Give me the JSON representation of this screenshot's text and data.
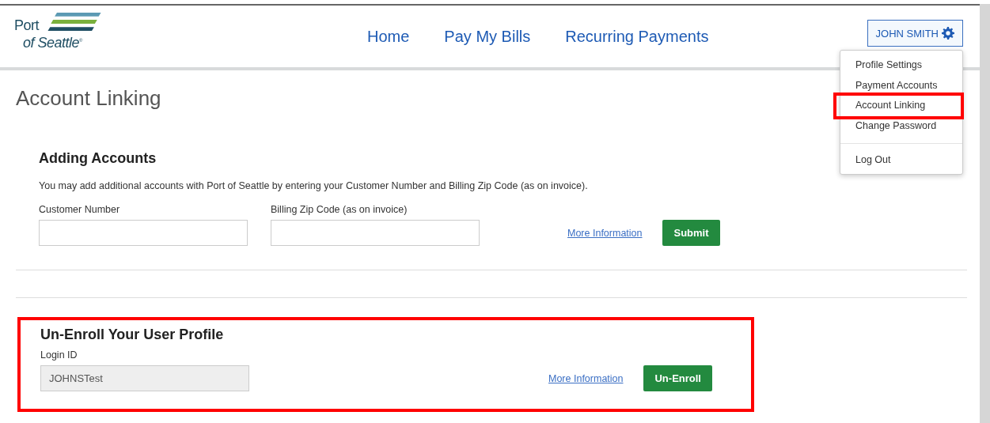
{
  "logo": {
    "line_1": "Port",
    "line_2": "of Seattle",
    "mark": "®"
  },
  "nav": [
    {
      "label": "Home"
    },
    {
      "label": "Pay My Bills"
    },
    {
      "label": "Recurring Payments"
    }
  ],
  "user_menu": {
    "label": "JOHN SMITH",
    "groups": [
      [
        {
          "label": "Profile Settings",
          "annotated": false
        },
        {
          "label": "Payment Accounts",
          "annotated": false
        },
        {
          "label": "Account Linking",
          "annotated": true
        },
        {
          "label": "Change Password",
          "annotated": false
        }
      ],
      [
        {
          "label": "Log Out",
          "annotated": false
        }
      ]
    ]
  },
  "page_title": "Account Linking",
  "sections": [
    {
      "kind": "adding",
      "annotated": false,
      "heading": "Adding Accounts",
      "text": "You may add additional accounts with Port of Seattle by entering your Customer Number and Billing Zip Code (as on invoice).",
      "fields": [
        {
          "label": "Customer Number",
          "disabled": false
        },
        {
          "label": "Billing Zip Code (as on invoice)",
          "disabled": false
        }
      ],
      "link": "More Information",
      "button": "Submit"
    },
    {
      "kind": "unenroll",
      "annotated": true,
      "heading": "Un-Enroll Your User Profile",
      "fields": [
        {
          "label": "Login ID",
          "value": "JOHNSTest",
          "disabled": true
        }
      ],
      "link": "More Information",
      "button": "Un-Enroll"
    }
  ]
}
